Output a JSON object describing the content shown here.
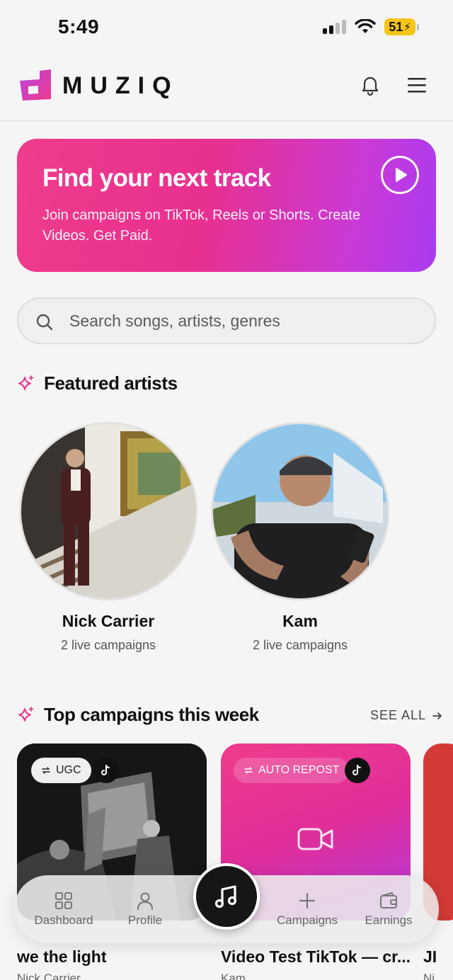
{
  "status_bar": {
    "time": "5:49",
    "battery": "51"
  },
  "header": {
    "logo_text": "MUZIQ"
  },
  "hero": {
    "title": "Find your next track",
    "subtitle": "Join campaigns on TikTok, Reels or Shorts. Create Videos. Get Paid."
  },
  "search": {
    "placeholder": "Search songs, artists, genres"
  },
  "featured": {
    "title": "Featured artists",
    "artists": [
      {
        "name": "Nick Carrier",
        "campaigns": "2 live campaigns"
      },
      {
        "name": "Kam",
        "campaigns": "2 live campaigns"
      }
    ]
  },
  "top_campaigns": {
    "title": "Top campaigns this week",
    "see_all": "SEE ALL",
    "cards": [
      {
        "badge": "UGC",
        "title": "we the light",
        "artist": "Nick Carrier"
      },
      {
        "badge": "AUTO REPOST",
        "title": "Video Test TikTok — cr...",
        "artist": "Kam"
      },
      {
        "badge": "",
        "title": "JI",
        "artist": "Ni"
      }
    ]
  },
  "bottom_nav": {
    "items": [
      {
        "label": "Dashboard",
        "icon": "grid-icon"
      },
      {
        "label": "Profile",
        "icon": "person-icon"
      },
      {
        "label": "Campaigns",
        "icon": "plus-icon"
      },
      {
        "label": "Earnings",
        "icon": "wallet-icon"
      }
    ],
    "center_icon": "music-note-icon"
  },
  "colors": {
    "accent_pink": "#ea3a8f",
    "accent_purple": "#a93bf0",
    "background": "#f5f5f5"
  }
}
